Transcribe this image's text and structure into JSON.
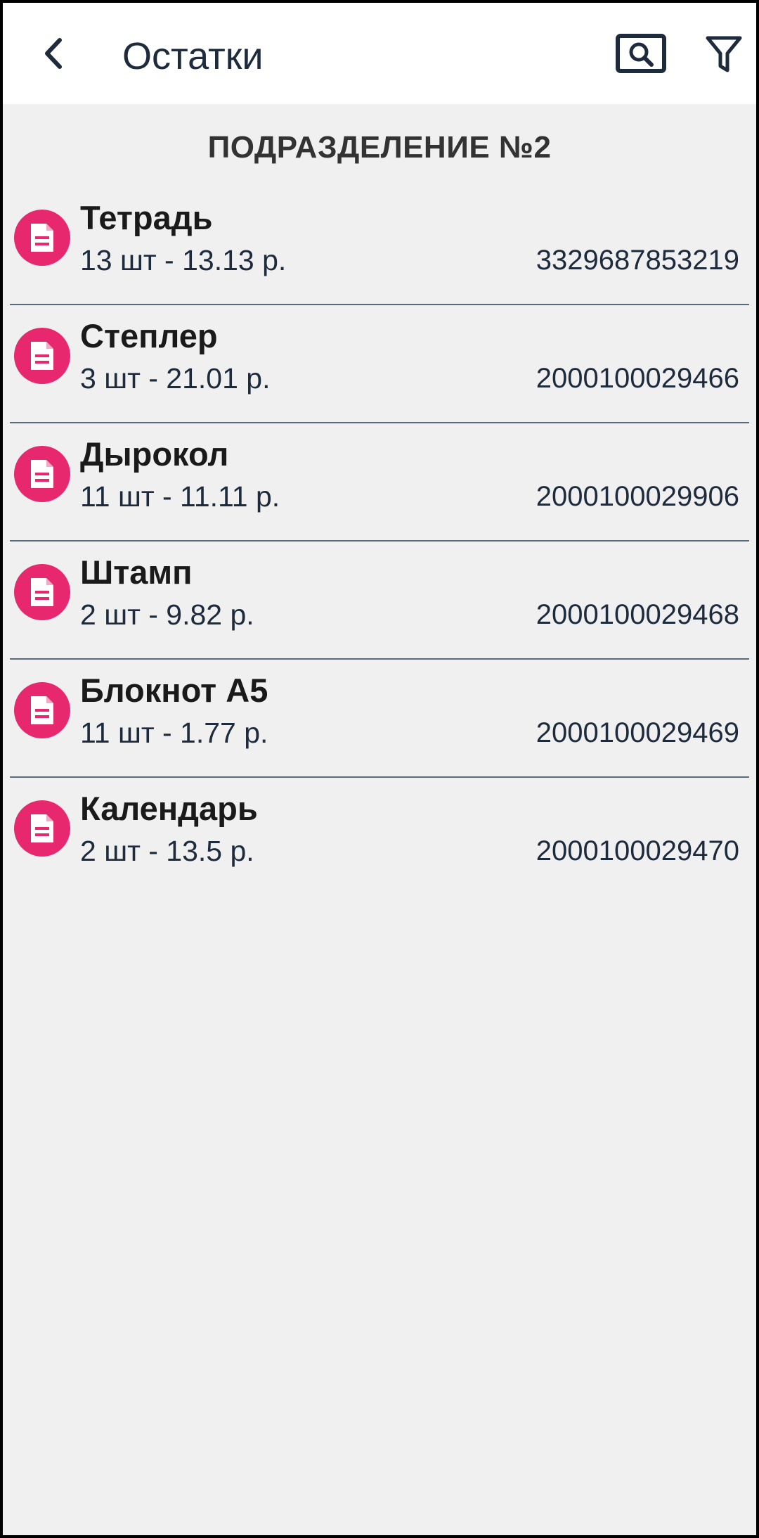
{
  "appbar": {
    "title": "Остатки",
    "back_icon": "chevron-left-icon",
    "search_icon": "search-icon",
    "filter_icon": "filter-icon"
  },
  "section": {
    "title": "ПОДРАЗДЕЛЕНИЕ №2"
  },
  "items": [
    {
      "name": "Тетрадь",
      "qty": "13 шт - 13.13 р.",
      "code": "3329687853219"
    },
    {
      "name": "Степлер",
      "qty": "3 шт - 21.01 р.",
      "code": "2000100029466"
    },
    {
      "name": "Дырокол",
      "qty": "11 шт - 11.11 р.",
      "code": "2000100029906"
    },
    {
      "name": "Штамп",
      "qty": "2 шт - 9.82 р.",
      "code": "2000100029468"
    },
    {
      "name": "Блокнот А5",
      "qty": "11 шт - 1.77 р.",
      "code": "2000100029469"
    },
    {
      "name": "Календарь",
      "qty": "2 шт - 13.5 р.",
      "code": "2000100029470"
    }
  ],
  "colors": {
    "accent": "#e8286e",
    "text_dark": "#1d2b3d",
    "background": "#f0f0f0"
  }
}
